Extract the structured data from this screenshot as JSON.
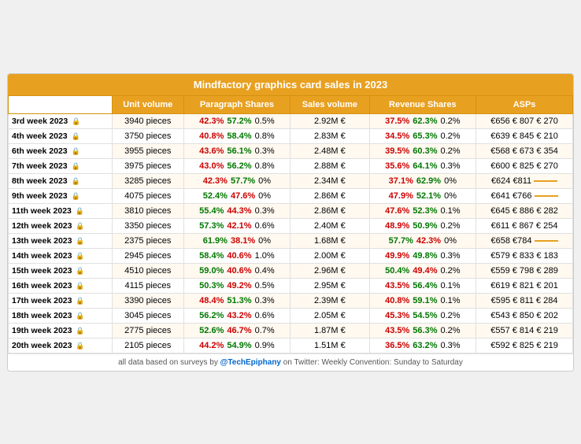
{
  "title": "Mindfactory graphics card sales in 2023",
  "headers": [
    "",
    "Unit volume",
    "Paragraph Shares",
    "Sales volume",
    "Revenue Shares",
    "ASPs"
  ],
  "rows": [
    {
      "week": "3rd week 2023",
      "unit_volume": "3940 pieces",
      "para_shares": [
        "42.3%",
        "57.2%",
        "0.5%"
      ],
      "para_colors": [
        "red",
        "green",
        "black"
      ],
      "sales_volume": "2.92M €",
      "rev_shares": [
        "37.5%",
        "62.3%",
        "0.2%"
      ],
      "rev_colors": [
        "red",
        "green",
        "black"
      ],
      "asps": [
        "€656 €",
        "807 €",
        "270"
      ],
      "asp_special": null
    },
    {
      "week": "4th week 2023",
      "unit_volume": "3750 pieces",
      "para_shares": [
        "40.8%",
        "58.4%",
        "0.8%"
      ],
      "para_colors": [
        "red",
        "green",
        "black"
      ],
      "sales_volume": "2.83M €",
      "rev_shares": [
        "34.5%",
        "65.3%",
        "0.2%"
      ],
      "rev_colors": [
        "red",
        "green",
        "black"
      ],
      "asps": [
        "€639 €",
        "845 €",
        "210"
      ],
      "asp_special": null
    },
    {
      "week": "6th week 2023",
      "unit_volume": "3955 pieces",
      "para_shares": [
        "43.6%",
        "56.1%",
        "0.3%"
      ],
      "para_colors": [
        "red",
        "green",
        "black"
      ],
      "sales_volume": "2.48M €",
      "rev_shares": [
        "39.5%",
        "60.3%",
        "0.2%"
      ],
      "rev_colors": [
        "red",
        "green",
        "black"
      ],
      "asps": [
        "€568 €",
        "673 €",
        "354"
      ],
      "asp_special": null
    },
    {
      "week": "7th week 2023",
      "unit_volume": "3975 pieces",
      "para_shares": [
        "43.0%",
        "56.2%",
        "0.8%"
      ],
      "para_colors": [
        "red",
        "green",
        "black"
      ],
      "sales_volume": "2.88M €",
      "rev_shares": [
        "35.6%",
        "64.1%",
        "0.3%"
      ],
      "rev_colors": [
        "red",
        "green",
        "black"
      ],
      "asps": [
        "€600 €",
        "825 €",
        "270"
      ],
      "asp_special": null
    },
    {
      "week": "8th week 2023",
      "unit_volume": "3285 pieces",
      "para_shares": [
        "42.3%",
        "57.7%",
        "0%"
      ],
      "para_colors": [
        "red",
        "green",
        "black"
      ],
      "sales_volume": "2.34M €",
      "rev_shares": [
        "37.1%",
        "62.9%",
        "0%"
      ],
      "rev_colors": [
        "red",
        "green",
        "black"
      ],
      "asps": [
        "€624",
        "€811",
        "dash"
      ],
      "asp_special": "dash"
    },
    {
      "week": "9th week 2023",
      "unit_volume": "4075 pieces",
      "para_shares": [
        "52.4%",
        "47.6%",
        "0%"
      ],
      "para_colors": [
        "green",
        "red",
        "black"
      ],
      "sales_volume": "2.86M €",
      "rev_shares": [
        "47.9%",
        "52.1%",
        "0%"
      ],
      "rev_colors": [
        "red",
        "green",
        "black"
      ],
      "asps": [
        "€641",
        "€766",
        "dash"
      ],
      "asp_special": "dash"
    },
    {
      "week": "11th week 2023",
      "unit_volume": "3810 pieces",
      "para_shares": [
        "55.4%",
        "44.3%",
        "0.3%"
      ],
      "para_colors": [
        "green",
        "red",
        "black"
      ],
      "sales_volume": "2.86M €",
      "rev_shares": [
        "47.6%",
        "52.3%",
        "0.1%"
      ],
      "rev_colors": [
        "red",
        "green",
        "black"
      ],
      "asps": [
        "€645 €",
        "886 €",
        "282"
      ],
      "asp_special": null
    },
    {
      "week": "12th week 2023",
      "unit_volume": "3350 pieces",
      "para_shares": [
        "57.3%",
        "42.1%",
        "0.6%"
      ],
      "para_colors": [
        "green",
        "red",
        "black"
      ],
      "sales_volume": "2.40M €",
      "rev_shares": [
        "48.9%",
        "50.9%",
        "0.2%"
      ],
      "rev_colors": [
        "red",
        "green",
        "black"
      ],
      "asps": [
        "€611 €",
        "867 €",
        "254"
      ],
      "asp_special": null
    },
    {
      "week": "13th week 2023",
      "unit_volume": "2375 pieces",
      "para_shares": [
        "61.9%",
        "38.1%",
        "0%"
      ],
      "para_colors": [
        "green",
        "red",
        "black"
      ],
      "sales_volume": "1.68M €",
      "rev_shares": [
        "57.7%",
        "42.3%",
        "0%"
      ],
      "rev_colors": [
        "green",
        "red",
        "black"
      ],
      "asps": [
        "€658",
        "€784",
        "dash"
      ],
      "asp_special": "dash"
    },
    {
      "week": "14th week 2023",
      "unit_volume": "2945 pieces",
      "para_shares": [
        "58.4%",
        "40.6%",
        "1.0%"
      ],
      "para_colors": [
        "green",
        "red",
        "black"
      ],
      "sales_volume": "2.00M €",
      "rev_shares": [
        "49.9%",
        "49.8%",
        "0.3%"
      ],
      "rev_colors": [
        "red",
        "green",
        "black"
      ],
      "asps": [
        "€579 €",
        "833 €",
        "183"
      ],
      "asp_special": null
    },
    {
      "week": "15th week 2023",
      "unit_volume": "4510 pieces",
      "para_shares": [
        "59.0%",
        "40.6%",
        "0.4%"
      ],
      "para_colors": [
        "green",
        "red",
        "black"
      ],
      "sales_volume": "2.96M €",
      "rev_shares": [
        "50.4%",
        "49.4%",
        "0.2%"
      ],
      "rev_colors": [
        "green",
        "red",
        "black"
      ],
      "asps": [
        "€559 €",
        "798 €",
        "289"
      ],
      "asp_special": null
    },
    {
      "week": "16th week 2023",
      "unit_volume": "4115 pieces",
      "para_shares": [
        "50.3%",
        "49.2%",
        "0.5%"
      ],
      "para_colors": [
        "green",
        "red",
        "black"
      ],
      "sales_volume": "2.95M €",
      "rev_shares": [
        "43.5%",
        "56.4%",
        "0.1%"
      ],
      "rev_colors": [
        "red",
        "green",
        "black"
      ],
      "asps": [
        "€619 €",
        "821 €",
        "201"
      ],
      "asp_special": null
    },
    {
      "week": "17th week 2023",
      "unit_volume": "3390 pieces",
      "para_shares": [
        "48.4%",
        "51.3%",
        "0.3%"
      ],
      "para_colors": [
        "red",
        "green",
        "black"
      ],
      "sales_volume": "2.39M €",
      "rev_shares": [
        "40.8%",
        "59.1%",
        "0.1%"
      ],
      "rev_colors": [
        "red",
        "green",
        "black"
      ],
      "asps": [
        "€595 €",
        "811 €",
        "284"
      ],
      "asp_special": null
    },
    {
      "week": "18th week 2023",
      "unit_volume": "3045 pieces",
      "para_shares": [
        "56.2%",
        "43.2%",
        "0.6%"
      ],
      "para_colors": [
        "green",
        "red",
        "black"
      ],
      "sales_volume": "2.05M €",
      "rev_shares": [
        "45.3%",
        "54.5%",
        "0.2%"
      ],
      "rev_colors": [
        "red",
        "green",
        "black"
      ],
      "asps": [
        "€543 €",
        "850 €",
        "202"
      ],
      "asp_special": null
    },
    {
      "week": "19th week 2023",
      "unit_volume": "2775 pieces",
      "para_shares": [
        "52.6%",
        "46.7%",
        "0.7%"
      ],
      "para_colors": [
        "green",
        "red",
        "black"
      ],
      "sales_volume": "1.87M €",
      "rev_shares": [
        "43.5%",
        "56.3%",
        "0.2%"
      ],
      "rev_colors": [
        "red",
        "green",
        "black"
      ],
      "asps": [
        "€557 €",
        "814 €",
        "219"
      ],
      "asp_special": null
    },
    {
      "week": "20th week 2023",
      "unit_volume": "2105 pieces",
      "para_shares": [
        "44.2%",
        "54.9%",
        "0.9%"
      ],
      "para_colors": [
        "red",
        "green",
        "black"
      ],
      "sales_volume": "1.51M €",
      "rev_shares": [
        "36.5%",
        "63.2%",
        "0.3%"
      ],
      "rev_colors": [
        "red",
        "green",
        "black"
      ],
      "asps": [
        "€592 €",
        "825 €",
        "219"
      ],
      "asp_special": null,
      "bold": true
    }
  ],
  "footer": "all data based on surveys by @TechEpiphany on Twitter: Weekly Convention: Sunday to Saturday",
  "footer_handle": "@TechEpiphany"
}
